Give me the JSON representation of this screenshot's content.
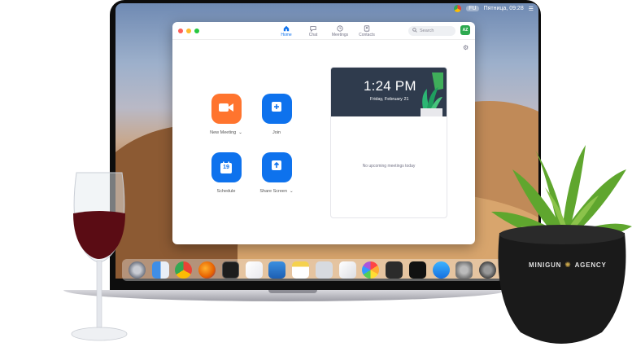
{
  "menubar": {
    "user_tag": "FU",
    "clock": "Пятница, 09:28"
  },
  "app": {
    "tabs": [
      {
        "label": "Home",
        "icon": "home-icon",
        "active": true
      },
      {
        "label": "Chat",
        "icon": "chat-icon",
        "active": false
      },
      {
        "label": "Meetings",
        "icon": "clock-icon",
        "active": false
      },
      {
        "label": "Contacts",
        "icon": "contacts-icon",
        "active": false
      }
    ],
    "search_placeholder": "Search",
    "avatar_initials": "AZ",
    "actions": [
      {
        "label": "New Meeting",
        "icon": "video-camera-icon",
        "color": "#ff742e",
        "has_menu": true
      },
      {
        "label": "Join",
        "icon": "plus-icon",
        "color": "#0e72ed",
        "has_menu": false
      },
      {
        "label": "Schedule",
        "icon": "calendar-icon",
        "color": "#0e72ed",
        "has_menu": false,
        "day_number": "19"
      },
      {
        "label": "Share Screen",
        "icon": "share-screen-icon",
        "color": "#0e72ed",
        "has_menu": true
      }
    ],
    "calendar": {
      "time": "1:24 PM",
      "date": "Friday, February 21",
      "empty_message": "No upcoming meetings today"
    }
  },
  "pot": {
    "brand_left": "MINIGUN",
    "brand_right": "AGENCY"
  },
  "dock": {
    "icons": [
      "launchpad-icon",
      "finder-icon",
      "chrome-icon",
      "firefox-icon",
      "terminal-icon",
      "music-icon",
      "keynote-icon",
      "notes-icon",
      "photo-viewer-icon",
      "pages-icon",
      "photos-icon",
      "calculator-icon",
      "stocks-icon",
      "app-store-icon",
      "system-preferences-icon",
      "settings-icon"
    ]
  }
}
